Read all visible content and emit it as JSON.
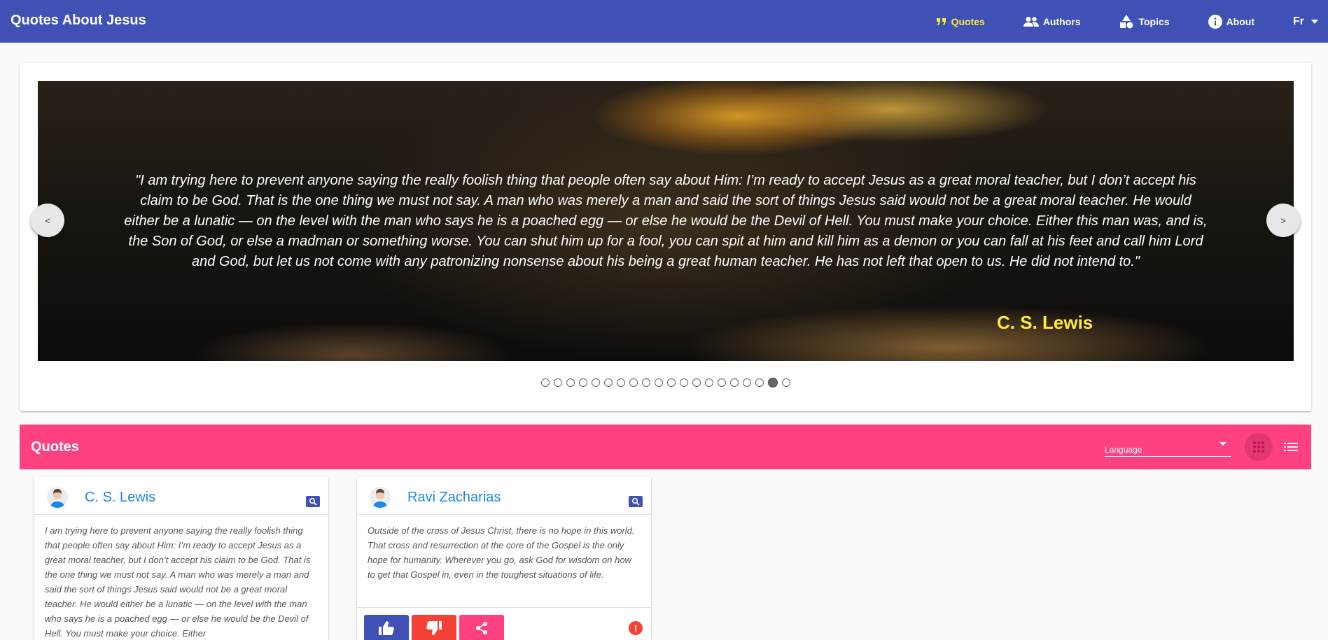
{
  "app": {
    "title": "Quotes About Jesus"
  },
  "nav": {
    "items": [
      {
        "label": "Quotes",
        "icon": "quote-icon",
        "active": true
      },
      {
        "label": "Authors",
        "icon": "people-icon",
        "active": false
      },
      {
        "label": "Topics",
        "icon": "shapes-icon",
        "active": false
      },
      {
        "label": "About",
        "icon": "info-icon",
        "active": false
      }
    ],
    "language": "Fr"
  },
  "carousel": {
    "quote": "\"I am trying here to prevent anyone saying the really foolish thing that people often say about Him: I’m ready to accept Jesus as a great moral teacher, but I don’t accept his claim to be God. That is the one thing we must not say. A man who was merely a man and said the sort of things Jesus said would not be a great moral teacher. He would either be a lunatic — on the level with the man who says he is a poached egg — or else he would be the Devil of Hell. You must make your choice. Either this man was, and is, the Son of God, or else a madman or something worse. You can shut him up for a fool, you can spit at him and kill him as a demon or you can fall at his feet and call him Lord and God, but let us not come with any patronizing nonsense about his being a great human teacher. He has not left that open to us. He did not intend to.\"",
    "author": "C. S. Lewis",
    "prev_label": "<",
    "next_label": ">",
    "slide_count": 20,
    "active_index": 18
  },
  "quotes_section": {
    "title": "Quotes",
    "language_label": "Language"
  },
  "quotes": [
    {
      "author": "C. S. Lewis",
      "text": "I am trying here to prevent anyone saying the really foolish thing that people often say about Him: I’m ready to accept Jesus as a great moral teacher, but I don’t accept his claim to be God. That is the one thing we must not say. A man who was merely a man and said the sort of things Jesus said would not be a great moral teacher. He would either be a lunatic — on the level with the man who says he is a poached egg — or else he would be the Devil of Hell. You must make your choice. Either"
    },
    {
      "author": "Ravi Zacharias",
      "text": "Outside of the cross of Jesus Christ, there is no hope in this world. That cross and resurrection at the core of the Gospel is the only hope for humanity. Wherever you go, ask God for wisdom on how to get that Gospel in, even in the toughest situations of life."
    }
  ],
  "colors": {
    "primary": "#3f51b5",
    "accent": "#ff4081",
    "active_nav": "#ffeb3b",
    "author_link": "#1e88e5",
    "dislike": "#f44336"
  }
}
